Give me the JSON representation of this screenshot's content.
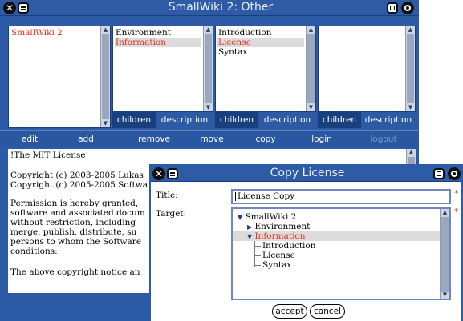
{
  "main": {
    "title": "SmallWiki 2: Other",
    "col1": {
      "items": [
        "SmallWiki 2"
      ],
      "selected": 0
    },
    "col2": {
      "items": [
        "Environment",
        "Information"
      ],
      "selected": 1
    },
    "col3": {
      "items": [
        "Introduction",
        "License",
        "Syntax"
      ],
      "selected": 1
    },
    "tabs": [
      {
        "children": "children",
        "description": "description"
      },
      {
        "children": "children",
        "description": "description"
      },
      {
        "children": "children",
        "description": "description"
      }
    ],
    "actions": [
      "edit",
      "add",
      "remove",
      "move",
      "copy",
      "login",
      "logout"
    ],
    "content_lines": [
      "!The MIT License",
      "",
      "Copyright (c) 2003-2005 Lukas",
      "Copyright (c) 2005-2005 Softwa",
      "",
      "Permission is hereby granted,",
      "software and associated docum",
      "without restriction, including",
      "merge, publish, distribute, su",
      "persons to whom the Software",
      "conditions:",
      "",
      "The above copyright notice an"
    ]
  },
  "dialog": {
    "title": "Copy License",
    "title_label": "Title:",
    "title_value": "License Copy",
    "target_label": "Target:",
    "required_mark": "*",
    "tree": [
      {
        "label": "SmallWiki 2",
        "expander": "▼"
      },
      {
        "label": "Environment",
        "expander": "▶"
      },
      {
        "label": "Information",
        "expander": "▼"
      },
      {
        "label": "Introduction",
        "expander": ""
      },
      {
        "label": "License",
        "expander": ""
      },
      {
        "label": "Syntax",
        "expander": ""
      }
    ],
    "accept_label": "accept",
    "cancel_label": "cancel"
  },
  "icons": {
    "close": "close-icon",
    "menu": "menu-icon",
    "collapse": "collapse-icon",
    "expand": "expand-icon"
  },
  "colors": {
    "chrome_blue": "#2c5aa4",
    "selection_red": "#e8301e",
    "active_tab": "#18407f"
  }
}
